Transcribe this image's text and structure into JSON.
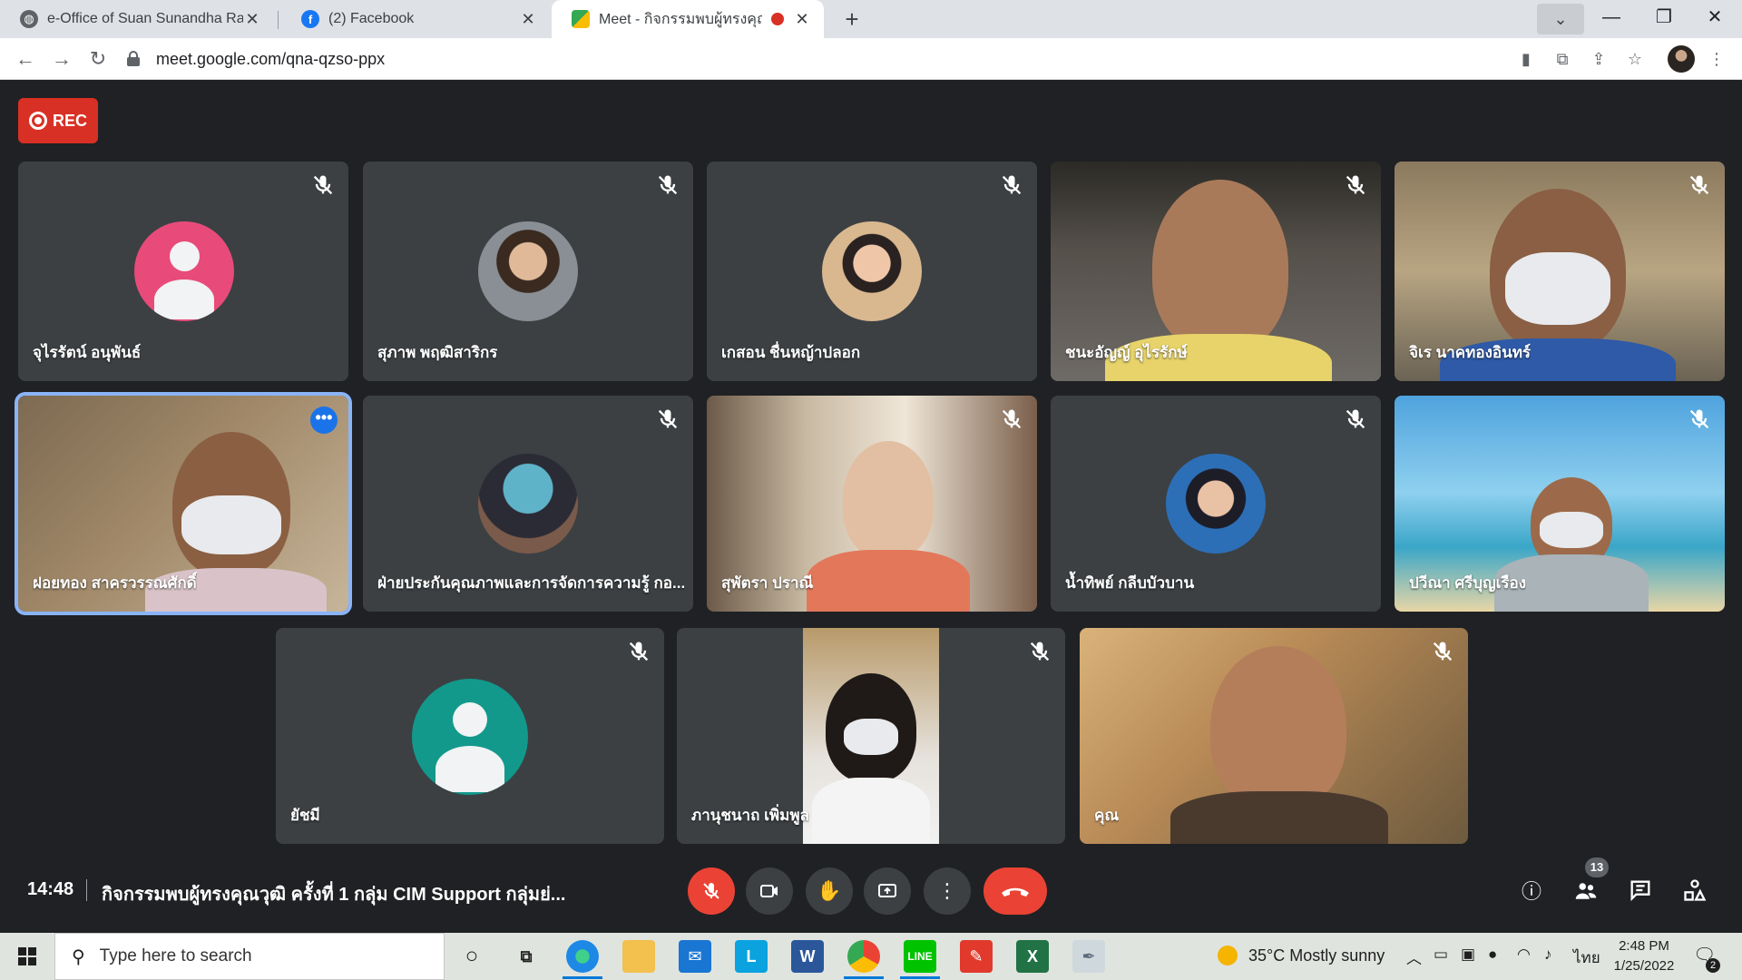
{
  "browser": {
    "tabs": [
      {
        "title": "e-Office of Suan Sunandha Rajab",
        "close": "✕"
      },
      {
        "title": "(2) Facebook",
        "close": "✕"
      },
      {
        "title": "Meet - กิจกรรมพบผู้ทรงคุณวุฒิ",
        "close": "✕"
      }
    ],
    "new_tab": "+",
    "url": "meet.google.com/qna-qzso-ppx"
  },
  "meet": {
    "rec_label": "REC",
    "tiles": [
      {
        "name": "จุไรรัตน์ อนุพันธ์"
      },
      {
        "name": "สุภาพ พฤฒิสาริกร"
      },
      {
        "name": "เกสอน ชื่นหญ้าปลอก"
      },
      {
        "name": "ชนะอัญญ์ อุไรรักษ์"
      },
      {
        "name": "จิเร นาคทองอินทร์"
      },
      {
        "name": "ฝอยทอง สาครวรรณศักดิ์"
      },
      {
        "name": "ฝ่ายประกันคุณภาพและการจัดการความรู้ กอ..."
      },
      {
        "name": "สุพัตรา ปราณี"
      },
      {
        "name": "น้ำทิพย์ กลีบบัวบาน"
      },
      {
        "name": "ปวีณา ศรีบุญเรือง"
      },
      {
        "name": "ยัชมี"
      },
      {
        "name": "ภานุชนาถ เพิ่มพูล"
      },
      {
        "name": "คุณ"
      }
    ],
    "bottom_bar": {
      "clock": "14:48",
      "meeting_title": "กิจกรรมพบผู้ทรงคุณวุฒิ ครั้งที่ 1 กลุ่ม CIM Support กลุ่มย่...",
      "participant_count": "13"
    }
  },
  "taskbar": {
    "search_placeholder": "Type here to search",
    "weather": "35°C  Mostly sunny",
    "language": "ไทย",
    "time": "2:48 PM",
    "date": "1/25/2022",
    "notifications": "2"
  },
  "colors": {
    "meet_bg": "#202124",
    "tile_bg": "#3c4043",
    "rec_red": "#d93025",
    "end_call_red": "#ea4335",
    "active_speaker": "#8ab4f8"
  }
}
